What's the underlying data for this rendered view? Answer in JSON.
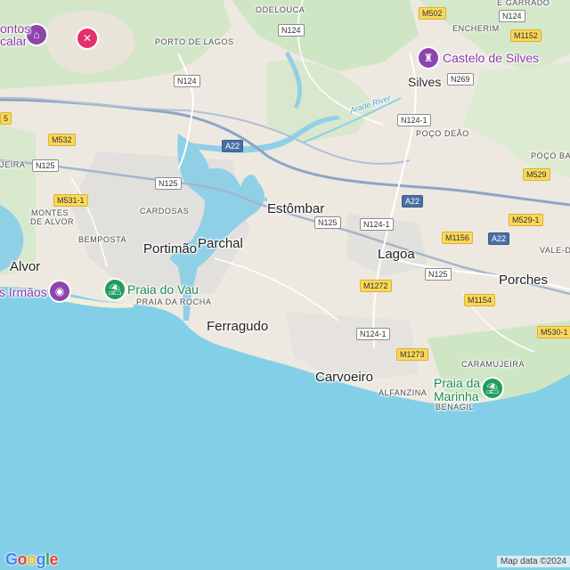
{
  "map": {
    "colors": {
      "sea": "#84cfe8",
      "land": "#ede9e0",
      "green": "#cde8c3",
      "estuary": "#8fd0e6",
      "highway": "#8da5c6",
      "road": "#ffffff",
      "shield_yellow": "#fbd75b"
    },
    "towns": [
      {
        "id": "odelouca",
        "text": "ODELOUCA"
      },
      {
        "id": "porto-de-lagos",
        "text": "PORTO DE LAGOS"
      },
      {
        "id": "silves",
        "text": "Silves"
      },
      {
        "id": "encherim",
        "text": "ENCHERIM"
      },
      {
        "id": "e-garrado",
        "text": "E GARRADO"
      },
      {
        "id": "poco-deao",
        "text": "POÇO DEÃO"
      },
      {
        "id": "poco-barreto",
        "text": "POÇO BAR"
      },
      {
        "id": "cardosas",
        "text": "CARDOSAS"
      },
      {
        "id": "montes-de-alvor-1",
        "text": "MONTES"
      },
      {
        "id": "montes-de-alvor-2",
        "text": "DE ALVOR"
      },
      {
        "id": "bemposta",
        "text": "BEMPOSTA"
      },
      {
        "id": "estombar",
        "text": "Estômbar"
      },
      {
        "id": "portimao",
        "text": "Portimão"
      },
      {
        "id": "parchal",
        "text": "Parchal"
      },
      {
        "id": "lagoa",
        "text": "Lagoa"
      },
      {
        "id": "alvor",
        "text": "Alvor"
      },
      {
        "id": "porches",
        "text": "Porches"
      },
      {
        "id": "vale-de",
        "text": "VALE-DE"
      },
      {
        "id": "praia-da-rocha",
        "text": "PRAIA DA ROCHA"
      },
      {
        "id": "ferragudo",
        "text": "Ferragudo"
      },
      {
        "id": "carvoeiro",
        "text": "Carvoeiro"
      },
      {
        "id": "caramujeira",
        "text": "CARAMUJEIRA"
      },
      {
        "id": "alfanzina",
        "text": "ALFANZINA"
      },
      {
        "id": "benagil",
        "text": "BENAGIL"
      },
      {
        "id": "jeira",
        "text": "JEIRA"
      },
      {
        "id": "calar",
        "text": "calar"
      }
    ],
    "pois": [
      {
        "id": "castelo-de-silves",
        "text": "Castelo de Silves",
        "icon": "castle-icon",
        "kind": "purple"
      },
      {
        "id": "praia-do-vau",
        "text": "Praia do Vau",
        "icon": "beach-icon",
        "kind": "green"
      },
      {
        "id": "praia-da-marinha-1",
        "text": "Praia da",
        "icon": "beach-icon",
        "kind": "green"
      },
      {
        "id": "praia-da-marinha-2",
        "text": "Marinha",
        "icon": "",
        "kind": "green"
      },
      {
        "id": "tres-irmaos",
        "text": "s Irmãos",
        "icon": "camera-icon",
        "kind": "purple"
      },
      {
        "id": "montes-calar",
        "text": "ontos",
        "icon": "museum-icon",
        "kind": "purple"
      }
    ],
    "river_label": "Arade River",
    "shields": [
      {
        "id": "m502",
        "text": "M502",
        "kind": "yellow"
      },
      {
        "id": "n124-top",
        "text": "N124",
        "kind": "white"
      },
      {
        "id": "n124-a",
        "text": "N124",
        "kind": "white"
      },
      {
        "id": "n124-b",
        "text": "N124",
        "kind": "white"
      },
      {
        "id": "m1152",
        "text": "M1152",
        "kind": "yellow"
      },
      {
        "id": "n269",
        "text": "N269",
        "kind": "white"
      },
      {
        "id": "n124-1-a",
        "text": "N124-1",
        "kind": "white"
      },
      {
        "id": "m532",
        "text": "M532",
        "kind": "yellow"
      },
      {
        "id": "n125-a",
        "text": "N125",
        "kind": "white"
      },
      {
        "id": "n125-b",
        "text": "N125",
        "kind": "white"
      },
      {
        "id": "a22-a",
        "text": "A22",
        "kind": "blue"
      },
      {
        "id": "m529",
        "text": "M529",
        "kind": "yellow"
      },
      {
        "id": "m531-1",
        "text": "M531-1",
        "kind": "yellow"
      },
      {
        "id": "a22-b",
        "text": "A22",
        "kind": "blue"
      },
      {
        "id": "n125-c",
        "text": "N125",
        "kind": "white"
      },
      {
        "id": "n124-1-b",
        "text": "N124-1",
        "kind": "white"
      },
      {
        "id": "m529-1",
        "text": "M529-1",
        "kind": "yellow"
      },
      {
        "id": "m1156",
        "text": "M1156",
        "kind": "yellow"
      },
      {
        "id": "a22-c",
        "text": "A22",
        "kind": "blue"
      },
      {
        "id": "n125-d",
        "text": "N125",
        "kind": "white"
      },
      {
        "id": "m1272",
        "text": "M1272",
        "kind": "yellow"
      },
      {
        "id": "m1154",
        "text": "M1154",
        "kind": "yellow"
      },
      {
        "id": "n124-1-c",
        "text": "N124-1",
        "kind": "white"
      },
      {
        "id": "m530-1",
        "text": "M530-1",
        "kind": "yellow"
      },
      {
        "id": "m1273",
        "text": "M1273",
        "kind": "yellow"
      },
      {
        "id": "edge-5",
        "text": "5",
        "kind": "yellow"
      }
    ],
    "branding": {
      "logo": "Google",
      "copyright": "Map data ©2024"
    }
  }
}
